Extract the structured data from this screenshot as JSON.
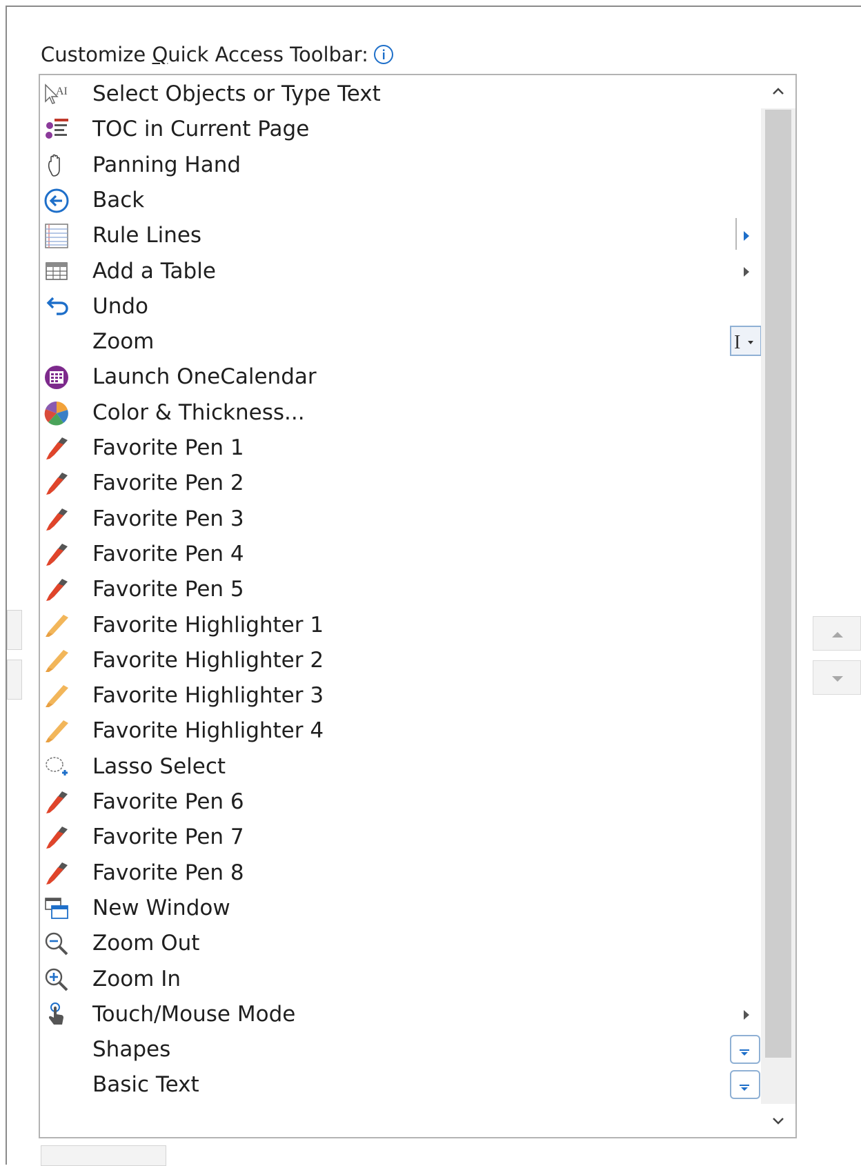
{
  "dialog": {
    "heading_prefix": "Customize ",
    "heading_accel": "Q",
    "heading_suffix": "uick Access Toolbar:"
  },
  "commands": [
    {
      "label": "Select Objects or Type Text",
      "icon": "select-type-icon"
    },
    {
      "label": "TOC in Current Page",
      "icon": "toc-icon"
    },
    {
      "label": "Panning Hand",
      "icon": "hand-icon"
    },
    {
      "label": "Back",
      "icon": "back-arrow-icon"
    },
    {
      "label": "Rule Lines",
      "icon": "rule-lines-icon",
      "submenu": true
    },
    {
      "label": "Add a Table",
      "icon": "table-icon",
      "submenu": true
    },
    {
      "label": "Undo",
      "icon": "undo-icon"
    },
    {
      "label": "Zoom",
      "icon": "",
      "control": "text"
    },
    {
      "label": "Launch OneCalendar",
      "icon": "onecalendar-icon"
    },
    {
      "label": "Color & Thickness...",
      "icon": "color-wheel-icon"
    },
    {
      "label": "Favorite Pen 1",
      "icon": "pen-icon"
    },
    {
      "label": "Favorite Pen 2",
      "icon": "pen-icon"
    },
    {
      "label": "Favorite Pen 3",
      "icon": "pen-icon"
    },
    {
      "label": "Favorite Pen 4",
      "icon": "pen-icon"
    },
    {
      "label": "Favorite Pen 5",
      "icon": "pen-icon"
    },
    {
      "label": "Favorite Highlighter 1",
      "icon": "highlighter-icon"
    },
    {
      "label": "Favorite Highlighter 2",
      "icon": "highlighter-icon"
    },
    {
      "label": "Favorite Highlighter 3",
      "icon": "highlighter-icon"
    },
    {
      "label": "Favorite Highlighter 4",
      "icon": "highlighter-icon"
    },
    {
      "label": "Lasso Select",
      "icon": "lasso-icon"
    },
    {
      "label": "Favorite Pen 6",
      "icon": "pen-icon"
    },
    {
      "label": "Favorite Pen 7",
      "icon": "pen-icon"
    },
    {
      "label": "Favorite Pen 8",
      "icon": "pen-icon"
    },
    {
      "label": "New Window",
      "icon": "new-window-icon"
    },
    {
      "label": "Zoom Out",
      "icon": "zoom-out-icon"
    },
    {
      "label": "Zoom In",
      "icon": "zoom-in-icon"
    },
    {
      "label": "Touch/Mouse Mode",
      "icon": "touch-icon",
      "submenu": true
    },
    {
      "label": "Shapes",
      "icon": "",
      "control": "gallery"
    },
    {
      "label": "Basic Text",
      "icon": "",
      "control": "gallery"
    }
  ],
  "colors": {
    "accent_blue": "#1e6fc9",
    "pen_red": "#e0442a",
    "highlighter_orange": "#f2b65a"
  }
}
